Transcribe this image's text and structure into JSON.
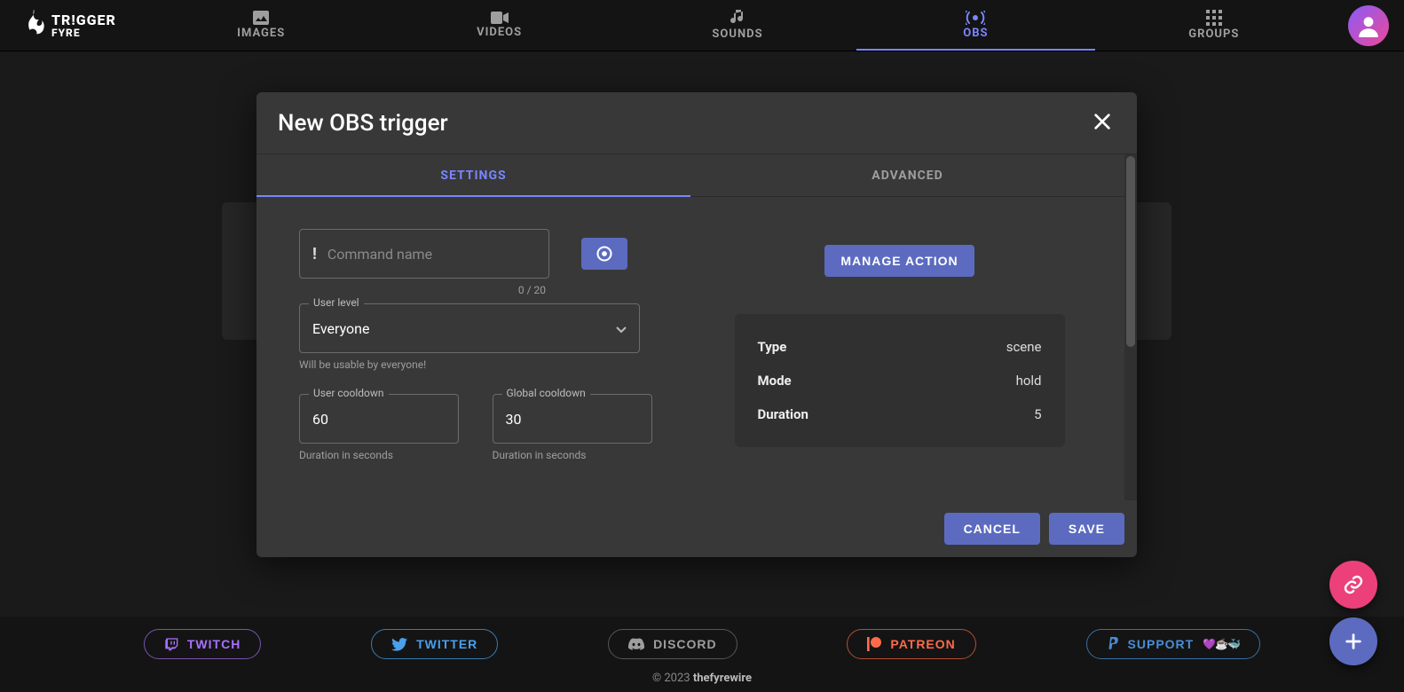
{
  "logo": {
    "line1": "TR!GGER",
    "line2": "FYRE"
  },
  "nav": {
    "items": [
      {
        "label": "IMAGES",
        "active": false
      },
      {
        "label": "VIDEOS",
        "active": false
      },
      {
        "label": "SOUNDS",
        "active": false
      },
      {
        "label": "OBS",
        "active": true
      },
      {
        "label": "GROUPS",
        "active": false
      }
    ]
  },
  "modal": {
    "title": "New OBS trigger",
    "tabs": {
      "settings": "SETTINGS",
      "advanced": "ADVANCED",
      "active": "settings"
    },
    "command": {
      "prefix": "!",
      "placeholder": "Command name",
      "value": "",
      "counter": "0 / 20"
    },
    "user_level": {
      "label": "User level",
      "value": "Everyone",
      "helper": "Will be usable by everyone!"
    },
    "user_cooldown": {
      "label": "User cooldown",
      "value": "60",
      "helper": "Duration in seconds"
    },
    "global_cooldown": {
      "label": "Global cooldown",
      "value": "30",
      "helper": "Duration in seconds"
    },
    "manage_action_label": "MANAGE ACTION",
    "action_info": {
      "rows": [
        {
          "k": "Type",
          "v": "scene"
        },
        {
          "k": "Mode",
          "v": "hold"
        },
        {
          "k": "Duration",
          "v": "5"
        }
      ]
    },
    "buttons": {
      "cancel": "CANCEL",
      "save": "SAVE"
    }
  },
  "footer": {
    "twitch": "TWITCH",
    "twitter": "TWITTER",
    "discord": "DISCORD",
    "patreon": "PATREON",
    "support": "SUPPORT",
    "support_emoji": "💜☕🐳",
    "copyright_prefix": "© 2023 ",
    "copyright_name": "thefyrewire"
  }
}
